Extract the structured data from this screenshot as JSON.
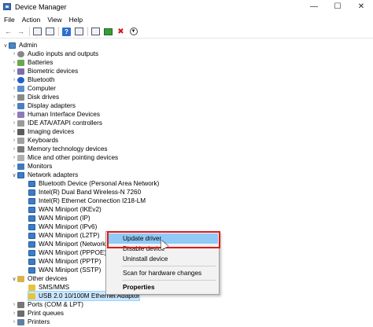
{
  "window": {
    "title": "Device Manager"
  },
  "menu": [
    "File",
    "Action",
    "View",
    "Help"
  ],
  "tree": {
    "root": "Admin",
    "categories": [
      "Audio inputs and outputs",
      "Batteries",
      "Biometric devices",
      "Bluetooth",
      "Computer",
      "Disk drives",
      "Display adapters",
      "Human Interface Devices",
      "IDE ATA/ATAPI controllers",
      "Imaging devices",
      "Keyboards",
      "Memory technology devices",
      "Mice and other pointing devices",
      "Monitors"
    ],
    "network_adapters": {
      "label": "Network adapters",
      "children": [
        "Bluetooth Device (Personal Area Network)",
        "Intel(R) Dual Band Wireless-N 7260",
        "Intel(R) Ethernet Connection I218-LM",
        "WAN Miniport (IKEv2)",
        "WAN Miniport (IP)",
        "WAN Miniport (IPv6)",
        "WAN Miniport (L2TP)",
        "WAN Miniport (Network M",
        "WAN Miniport (PPPOE)",
        "WAN Miniport (PPTP)",
        "WAN Miniport (SSTP)"
      ]
    },
    "other_devices": {
      "label": "Other devices",
      "children": [
        "SMS/MMS",
        "USB 2.0 10/100M Ethernet Adaptor"
      ]
    },
    "after": [
      "Ports (COM & LPT)",
      "Print queues",
      "Printers"
    ]
  },
  "context_menu": {
    "items": [
      "Update driver",
      "Disable device",
      "Uninstall device",
      "Scan for hardware changes",
      "Properties"
    ]
  }
}
